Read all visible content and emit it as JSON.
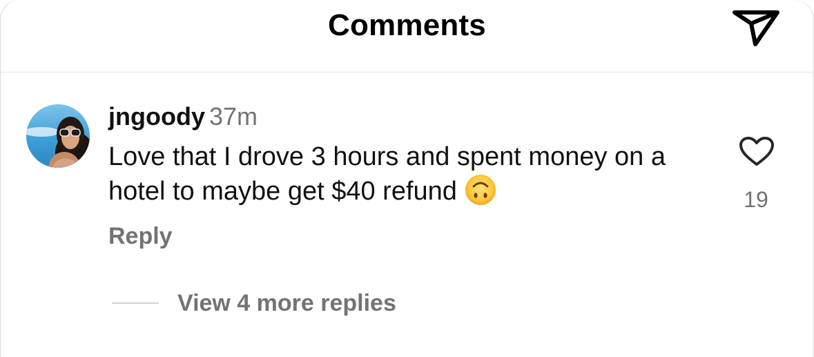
{
  "header": {
    "title": "Comments",
    "share_icon": "send-icon"
  },
  "comment": {
    "avatar_icon": "user-avatar",
    "username": "jngoody",
    "time": "37m",
    "text": "Love that I drove 3 hours and spent money on a hotel to maybe get $40 refund",
    "emoji": "upside-down-face",
    "reply_label": "Reply",
    "like_icon": "heart-icon",
    "like_count": "19",
    "view_replies_label": "View 4 more replies"
  }
}
